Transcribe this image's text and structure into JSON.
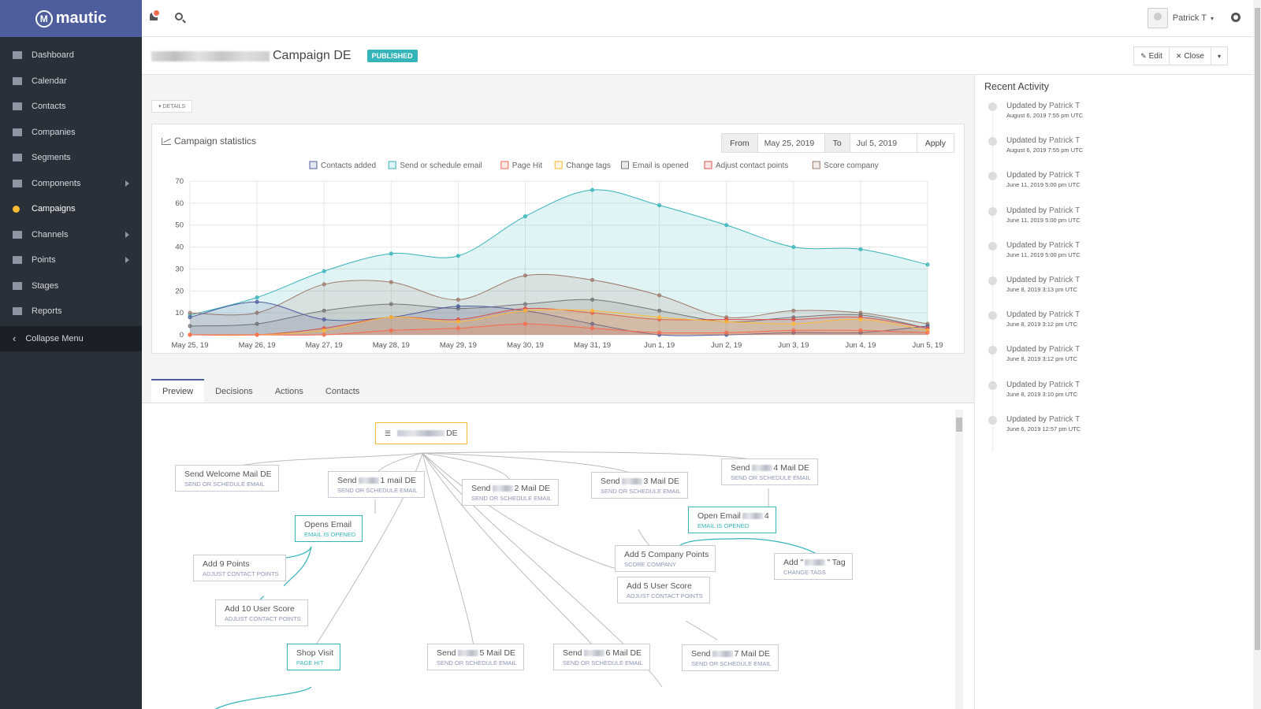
{
  "brand": {
    "name": "mautic"
  },
  "nav": {
    "items": [
      {
        "label": "Dashboard",
        "icon": "dashboard-icon",
        "submenu": false
      },
      {
        "label": "Calendar",
        "icon": "calendar-icon",
        "submenu": false
      },
      {
        "label": "Contacts",
        "icon": "user-icon",
        "submenu": false
      },
      {
        "label": "Companies",
        "icon": "building-icon",
        "submenu": false
      },
      {
        "label": "Segments",
        "icon": "pie-chart-icon",
        "submenu": false
      },
      {
        "label": "Components",
        "icon": "puzzle-icon",
        "submenu": true
      },
      {
        "label": "Campaigns",
        "icon": "clock-icon",
        "submenu": false,
        "active": true
      },
      {
        "label": "Channels",
        "icon": "rss-icon",
        "submenu": true
      },
      {
        "label": "Points",
        "icon": "calculator-icon",
        "submenu": true
      },
      {
        "label": "Stages",
        "icon": "tachometer-icon",
        "submenu": false
      },
      {
        "label": "Reports",
        "icon": "line-chart-icon",
        "submenu": false
      }
    ],
    "collapse_label": "Collapse Menu"
  },
  "topbar": {
    "user_name": "Patrick T"
  },
  "header": {
    "title": "Campaign DE",
    "status": "PUBLISHED",
    "edit_label": "Edit",
    "close_label": "Close"
  },
  "details_toggle": "DETAILS",
  "stats": {
    "title": "Campaign statistics",
    "from_label": "From",
    "from_value": "May 25, 2019",
    "to_label": "To",
    "to_value": "Jul 5, 2019",
    "apply_label": "Apply"
  },
  "chart_data": {
    "type": "area",
    "categories": [
      "May 25, 19",
      "May 26, 19",
      "May 27, 19",
      "May 28, 19",
      "May 29, 19",
      "May 30, 19",
      "May 31, 19",
      "Jun 1, 19",
      "Jun 2, 19",
      "Jun 3, 19",
      "Jun 4, 19",
      "Jun 5, 19"
    ],
    "ylim": [
      0,
      70
    ],
    "yticks": [
      0,
      10,
      20,
      30,
      40,
      50,
      60,
      70
    ],
    "legend_position": "top",
    "grid": true,
    "series": [
      {
        "name": "Contacts added",
        "color": "#4e5d9d",
        "values": [
          8,
          15,
          7,
          8,
          13,
          11,
          5,
          0,
          0,
          1,
          1,
          4
        ]
      },
      {
        "name": "Send or schedule email",
        "color": "#35b4b9",
        "values": [
          9,
          17,
          29,
          37,
          36,
          54,
          66,
          59,
          50,
          40,
          39,
          32
        ]
      },
      {
        "name": "Page Hit",
        "color": "#f86b4f",
        "values": [
          0,
          0,
          0,
          2,
          3,
          5,
          3,
          1,
          1,
          2,
          2,
          1
        ]
      },
      {
        "name": "Change tags",
        "color": "#fdb933",
        "values": [
          0,
          0,
          2,
          8,
          6,
          11,
          11,
          8,
          6,
          5,
          7,
          2
        ]
      },
      {
        "name": "Email is opened",
        "color": "#757575",
        "values": [
          4,
          5,
          11,
          14,
          12,
          14,
          16,
          11,
          6,
          8,
          9,
          3
        ]
      },
      {
        "name": "Adjust contact points",
        "color": "#d8524e",
        "values": [
          0,
          0,
          3,
          8,
          7,
          12,
          10,
          7,
          7,
          7,
          8,
          3
        ]
      },
      {
        "name": "Score company",
        "color": "#9e7b6a",
        "values": [
          10,
          10,
          23,
          24,
          16,
          27,
          25,
          18,
          8,
          11,
          10,
          5
        ]
      }
    ]
  },
  "tabs": [
    "Preview",
    "Decisions",
    "Actions",
    "Contacts"
  ],
  "flow": {
    "start": {
      "label": "DE"
    },
    "nodes": [
      {
        "id": "welcome",
        "title": "Send Welcome Mail DE",
        "sub": "Send or schedule email",
        "kind": "action"
      },
      {
        "id": "mail1",
        "title_pre": "Send",
        "title_post": "1 mail DE",
        "sub": "Send or schedule email",
        "kind": "action"
      },
      {
        "id": "mail2",
        "title_pre": "Send",
        "title_post": "2 Mail DE",
        "sub": "Send or schedule email",
        "kind": "action"
      },
      {
        "id": "mail3",
        "title_pre": "Send",
        "title_post": "3 Mail DE",
        "sub": "Send or schedule email",
        "kind": "action"
      },
      {
        "id": "mail4",
        "title_pre": "Send",
        "title_post": "4 Mail DE",
        "sub": "Send or schedule email",
        "kind": "action"
      },
      {
        "id": "opens",
        "title": "Opens Email",
        "sub": "Email is opened",
        "kind": "decision"
      },
      {
        "id": "open4",
        "title_pre": "Open Email",
        "title_post": "4",
        "sub": "Email is opened",
        "kind": "decision"
      },
      {
        "id": "pts9",
        "title": "Add 9 Points",
        "sub": "Adjust contact points",
        "kind": "action"
      },
      {
        "id": "company5",
        "title": "Add 5 Company Points",
        "sub": "Score company",
        "kind": "action"
      },
      {
        "id": "tag",
        "title_pre": "Add \"",
        "title_post": "\" Tag",
        "sub": "Change tags",
        "kind": "action"
      },
      {
        "id": "user5",
        "title": "Add 5 User Score",
        "sub": "Adjust contact points",
        "kind": "action"
      },
      {
        "id": "user10",
        "title": "Add 10 User Score",
        "sub": "Adjust contact points",
        "kind": "action"
      },
      {
        "id": "shop",
        "title": "Shop Visit",
        "sub": "Page hit",
        "kind": "decision"
      },
      {
        "id": "mail5",
        "title_pre": "Send",
        "title_post": "5 Mail DE",
        "sub": "Send or schedule email",
        "kind": "action"
      },
      {
        "id": "mail6",
        "title_pre": "Send",
        "title_post": "6 Mail DE",
        "sub": "Send or schedule email",
        "kind": "action"
      },
      {
        "id": "mail7",
        "title_pre": "Send",
        "title_post": "7 Mail DE",
        "sub": "Send or schedule email",
        "kind": "action"
      }
    ]
  },
  "activity": {
    "title": "Recent Activity",
    "prefix": "Updated by",
    "items": [
      {
        "user": "Patrick T",
        "date": "August 6, 2019 7:55 pm UTC"
      },
      {
        "user": "Patrick T",
        "date": "August 6, 2019 7:55 pm UTC"
      },
      {
        "user": "Patrick T",
        "date": "June 11, 2019 5:00 pm UTC"
      },
      {
        "user": "Patrick T",
        "date": "June 11, 2019 5:00 pm UTC"
      },
      {
        "user": "Patrick T",
        "date": "June 11, 2019 5:00 pm UTC"
      },
      {
        "user": "Patrick T",
        "date": "June 8, 2019 3:13 pm UTC"
      },
      {
        "user": "Patrick T",
        "date": "June 8, 2019 3:12 pm UTC"
      },
      {
        "user": "Patrick T",
        "date": "June 8, 2019 3:12 pm UTC"
      },
      {
        "user": "Patrick T",
        "date": "June 8, 2019 3:10 pm UTC"
      },
      {
        "user": "Patrick T",
        "date": "June 6, 2019 12:57 pm UTC"
      }
    ]
  }
}
